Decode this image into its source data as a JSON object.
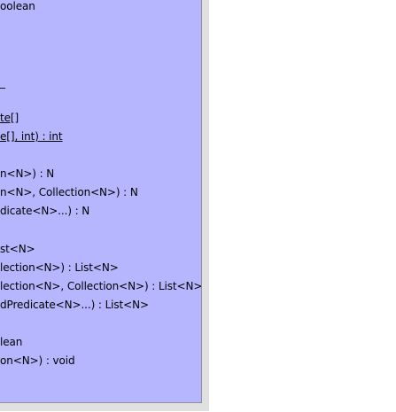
{
  "colors": {
    "box_fill": "#b6b6fe",
    "box_border": "#8f8f9c",
    "shadow": "#e0e0e0",
    "text": "#000000"
  },
  "operations": [
    {
      "text": "oolean",
      "static": false
    },
    {
      "text": "_",
      "static": false
    },
    {
      "text": "te[]",
      "static": true
    },
    {
      "text": "e[], int) : int",
      "static": true
    },
    {
      "text": "n<N>) : N",
      "static": false
    },
    {
      "text": "n<N>, Collection<N>) : N",
      "static": false
    },
    {
      "text": "dicate<N>...) : N",
      "static": false
    },
    {
      "text": "st<N>",
      "static": false
    },
    {
      "text": "lection<N>) : List<N>",
      "static": false
    },
    {
      "text": "lection<N>, Collection<N>) : List<N>",
      "static": false
    },
    {
      "text": "dPredicate<N>...) : List<N>",
      "static": false
    },
    {
      "text": "lean",
      "static": false
    },
    {
      "text": "on<N>) : void",
      "static": false
    }
  ]
}
